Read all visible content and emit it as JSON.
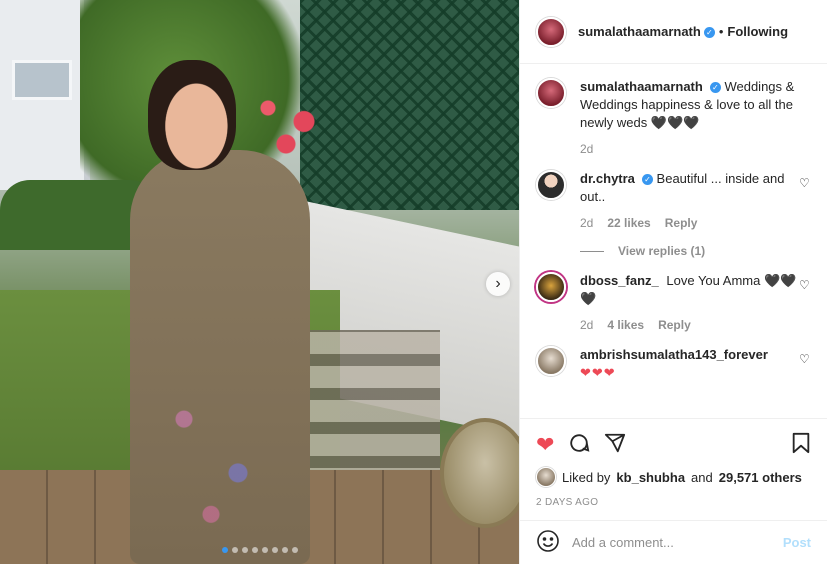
{
  "post": {
    "author": "sumalathaamarnath",
    "separator": "•",
    "follow_status": "Following",
    "caption": "Weddings & Weddings happiness & love to all the newly weds 🖤🖤🖤",
    "caption_age": "2d",
    "carousel": {
      "total_slides": 8,
      "active_slide": 1
    },
    "next_icon": "chevron-right-icon"
  },
  "comments": [
    {
      "user": "dr.chytra",
      "verified": true,
      "text": "Beautiful ... inside and out..",
      "age": "2d",
      "likes": "22 likes",
      "reply": "Reply",
      "view_replies": "View replies (1)"
    },
    {
      "user": "dboss_fanz_",
      "verified": false,
      "text": "Love You Amma 🖤🖤🖤",
      "age": "2d",
      "likes": "4 likes",
      "reply": "Reply"
    },
    {
      "user": "ambrishsumalatha143_forever",
      "verified": false,
      "text": "❤❤❤"
    }
  ],
  "actions": {
    "like_icon": "heart-icon",
    "comment_icon": "comment-icon",
    "share_icon": "share-icon",
    "save_icon": "bookmark-icon",
    "liked_by_prefix": "Liked by",
    "liked_by_user": "kb_shubha",
    "liked_by_and": "and",
    "liked_by_count": "29,571 others",
    "date": "2 DAYS AGO"
  },
  "add_comment": {
    "emoji_icon": "emoji-icon",
    "placeholder": "Add a comment...",
    "post_label": "Post"
  },
  "colors": {
    "accent": "#3897f0",
    "like_red": "#ed4956",
    "post_disabled": "#b2dffc"
  }
}
